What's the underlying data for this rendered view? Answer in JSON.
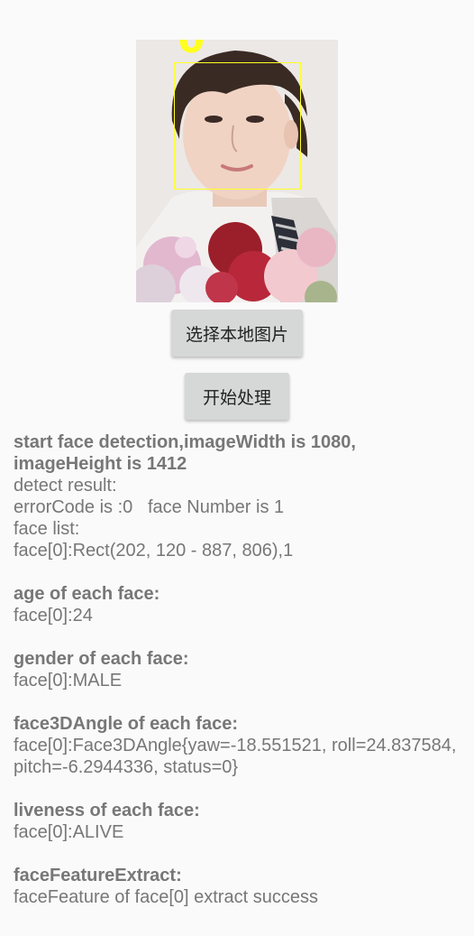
{
  "photo": {
    "face_index_label": "0"
  },
  "buttons": {
    "select_image": "选择本地图片",
    "start_process": "开始处理"
  },
  "log": {
    "header": "start face detection,imageWidth is 1080, imageHeight is 1412",
    "detect_result": "detect result:",
    "error_line": "errorCode is :0   face Number is 1",
    "face_list_label": "face list:",
    "face_rect": "face[0]:Rect(202, 120 - 887, 806),1",
    "age_title": "age of each face:",
    "age_value": "face[0]:24",
    "gender_title": "gender of each face:",
    "gender_value": "face[0]:MALE",
    "angle_title": "face3DAngle of each face:",
    "angle_value": "face[0]:Face3DAngle{yaw=-18.551521, roll=24.837584, pitch=-6.2944336, status=0}",
    "liveness_title": "liveness of each face:",
    "liveness_value": "face[0]:ALIVE",
    "feature_title": "faceFeatureExtract:",
    "feature_value": "faceFeature of face[0] extract success"
  },
  "colors": {
    "background": "#fafafa",
    "face_box": "#ffff22",
    "button": "#d6d7d7",
    "log_text": "#777777"
  }
}
